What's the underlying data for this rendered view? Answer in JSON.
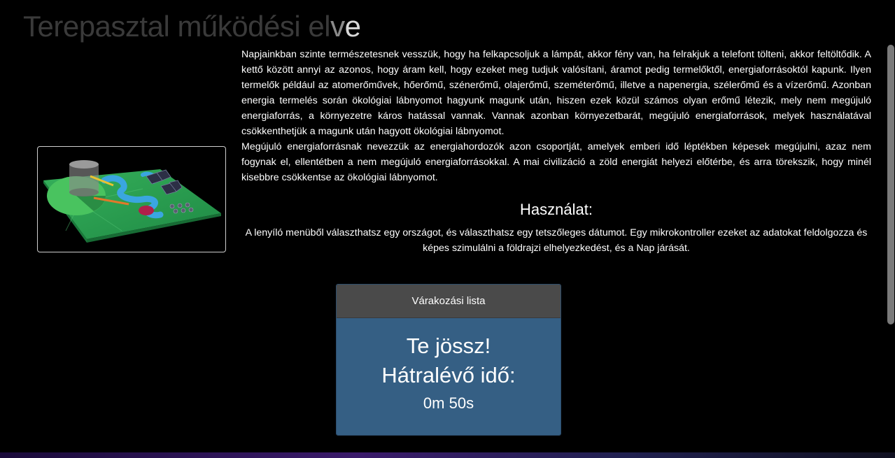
{
  "modal": {
    "title": "Terepasztal működési elve",
    "title_parts": [
      "Terepasztal működési el",
      "v",
      "e"
    ]
  },
  "description": {
    "paragraph1": "Napjainkban szinte természetesnek vesszük, hogy ha felkapcsoljuk a lámpát, akkor fény van, ha felrakjuk a telefont tölteni, akkor feltöltődik. A kettő között annyi az azonos, hogy áram kell, hogy ezeket meg tudjuk valósítani, áramot pedig termelőktől, energiaforrásoktól kapunk. Ilyen termelők például az atomerőművek, hőerőmű, szénerőmű, olajerőmű, szeméterőmű, illetve a napenergia, szélerőmű és a vízerőmű. Azonban energia termelés során ökológiai lábnyomot hagyunk magunk után, hiszen ezek közül számos olyan erőmű létezik, mely nem megújuló energiaforrás, a környezetre káros hatással vannak. Vannak azonban környezetbarát, megújuló energiaforrások, melyek használatával csökkenthetjük a magunk után hagyott ökológiai lábnyomot.",
    "paragraph2": "Megújuló energiaforrásnak nevezzük az energiahordozók azon csoportját, amelyek emberi idő léptékben képesek megújulni, azaz nem fogynak el, ellentétben a nem megújuló energiaforrásokkal. A mai civilizáció a zöld energiát helyezi előtérbe, és arra törekszik, hogy minél kisebbre csökkentse az ökológiai lábnyomot."
  },
  "usage": {
    "heading": "Használat:",
    "text": "A lenyíló menüből választhatsz egy országot, és választhatsz egy tetszőleges dátumot. Egy mikrokontroller ezeket az adatokat feldolgozza és képes szimulálni a földrajzi elhelyezkedést, és a Nap járását."
  },
  "queue": {
    "header": "Várakozási lista",
    "turn_text": "Te jössz!",
    "remaining_label": "Hátralévő idő:",
    "remaining_time": "0m 50s"
  },
  "colors": {
    "background": "#000000",
    "queue_header": "#4a4a4a",
    "queue_body": "#355f84",
    "board_green": "#2e9e50",
    "water_blue": "#3aa6e0"
  }
}
